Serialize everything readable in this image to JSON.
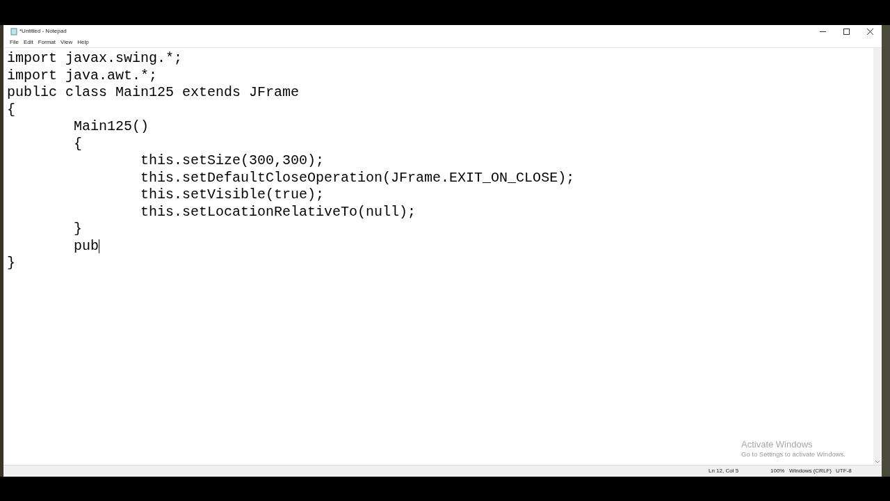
{
  "window": {
    "title": "*Untitled - Notepad"
  },
  "menu": [
    "File",
    "Edit",
    "Format",
    "View",
    "Help"
  ],
  "editor": {
    "lines": [
      "import javax.swing.*;",
      "import java.awt.*;",
      "public class Main125 extends JFrame",
      "{",
      "\tMain125()",
      "\t{",
      "\t\tthis.setSize(300,300);",
      "\t\tthis.setDefaultCloseOperation(JFrame.EXIT_ON_CLOSE);",
      "\t\tthis.setVisible(true);",
      "\t\tthis.setLocationRelativeTo(null);",
      "\t}",
      "\tpub",
      "}"
    ]
  },
  "activation": {
    "title": "Activate Windows",
    "message": "Go to Settings to activate Windows."
  },
  "status_bar": [
    "Ln 12, Col 5",
    "100%",
    "Windows (CRLF)",
    "UTF-8"
  ]
}
